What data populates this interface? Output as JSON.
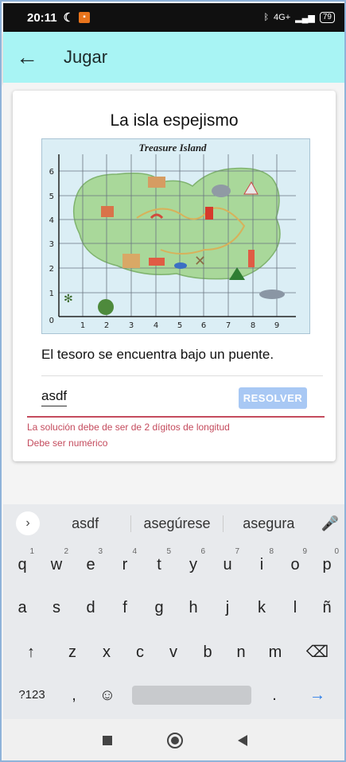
{
  "status_bar": {
    "time": "20:11",
    "network": "4G+",
    "battery": "79"
  },
  "app_bar": {
    "title": "Jugar"
  },
  "card": {
    "title": "La isla espejismo",
    "map": {
      "title": "Treasure Island",
      "x_ticks": [
        "1",
        "2",
        "3",
        "4",
        "5",
        "6",
        "7",
        "8",
        "9"
      ],
      "y_ticks": [
        "0",
        "1",
        "2",
        "3",
        "4",
        "5",
        "6"
      ]
    },
    "hint": "El tesoro se encuentra bajo un puente.",
    "answer_value": "asdf",
    "solve_label": "RESOLVER",
    "errors": [
      "La solución debe de ser de 2 dígitos de longitud",
      "Debe ser numérico"
    ]
  },
  "keyboard": {
    "suggestions": [
      "asdf",
      "asegúrese",
      "asegura"
    ],
    "row1": [
      {
        "k": "q",
        "n": "1"
      },
      {
        "k": "w",
        "n": "2"
      },
      {
        "k": "e",
        "n": "3"
      },
      {
        "k": "r",
        "n": "4"
      },
      {
        "k": "t",
        "n": "5"
      },
      {
        "k": "y",
        "n": "6"
      },
      {
        "k": "u",
        "n": "7"
      },
      {
        "k": "i",
        "n": "8"
      },
      {
        "k": "o",
        "n": "9"
      },
      {
        "k": "p",
        "n": "0"
      }
    ],
    "row2": [
      "a",
      "s",
      "d",
      "f",
      "g",
      "h",
      "j",
      "k",
      "l",
      "ñ"
    ],
    "row3": [
      "z",
      "x",
      "c",
      "v",
      "b",
      "n",
      "m"
    ],
    "symbols_label": "?123",
    "comma": ",",
    "period": "."
  },
  "colors": {
    "app_bar": "#a8f4f4",
    "error": "#c44b5d",
    "button": "#a8c8f4"
  }
}
